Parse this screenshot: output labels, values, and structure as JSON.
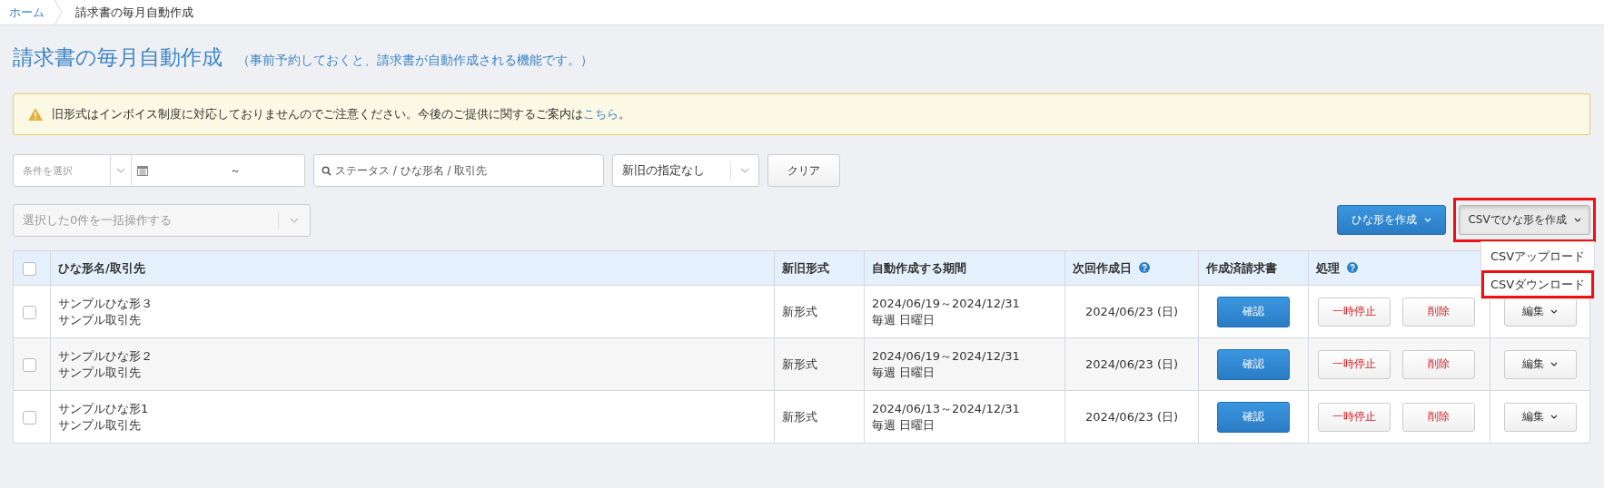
{
  "breadcrumb": [
    {
      "label": "ホーム",
      "link": true
    },
    {
      "label": "請求書の毎月自動作成",
      "link": false
    }
  ],
  "title": "請求書の毎月自動作成",
  "subtitle": "（事前予約しておくと、請求書が自動作成される機能です。）",
  "alert": {
    "text": "旧形式はインボイス制度に対応しておりませんのでご注意ください。今後のご提供に関するご案内は",
    "link": "こちら",
    "tail": "。"
  },
  "filters": {
    "condition_placeholder": "条件を選択",
    "date_separator": "～",
    "search_placeholder": "ステータス / ひな形名 / 取引先",
    "format_select": "新旧の指定なし",
    "clear_button": "クリア"
  },
  "bulk_select": {
    "placeholder": "選択した0件を一括操作する"
  },
  "create_button": "ひな形を作成",
  "csv_button": {
    "label": "CSVでひな形を作成",
    "highlighted": true,
    "expanded": true
  },
  "csv_menu": [
    {
      "label": "CSVアップロード",
      "highlighted": false
    },
    {
      "label": "CSVダウンロード",
      "highlighted": true
    }
  ],
  "table": {
    "columns": [
      {
        "label": "ひな形名/取引先",
        "help": false
      },
      {
        "label": "新旧形式",
        "help": false
      },
      {
        "label": "自動作成する期間",
        "help": false
      },
      {
        "label": "次回作成日",
        "help": true
      },
      {
        "label": "作成済請求書",
        "help": false
      },
      {
        "label": "処理",
        "help": true
      }
    ],
    "header_checked": false,
    "rows": [
      {
        "checked": false,
        "name": "サンプルひな形３",
        "client": "サンプル取引先",
        "format": "新形式",
        "period": "2024/06/19～2024/12/31",
        "schedule": "毎週 日曜日",
        "next_date": "2024/06/23 (日)",
        "view": "確認",
        "pause": "一時停止",
        "delete": "削除",
        "edit": "編集"
      },
      {
        "checked": false,
        "name": "サンプルひな形２",
        "client": "サンプル取引先",
        "format": "新形式",
        "period": "2024/06/19～2024/12/31",
        "schedule": "毎週 日曜日",
        "next_date": "2024/06/23 (日)",
        "view": "確認",
        "pause": "一時停止",
        "delete": "削除",
        "edit": "編集"
      },
      {
        "checked": false,
        "name": "サンプルひな形1",
        "client": "サンプル取引先",
        "format": "新形式",
        "period": "2024/06/13～2024/12/31",
        "schedule": "毎週 日曜日",
        "next_date": "2024/06/23 (日)",
        "view": "確認",
        "pause": "一時停止",
        "delete": "削除",
        "edit": "編集"
      }
    ]
  }
}
